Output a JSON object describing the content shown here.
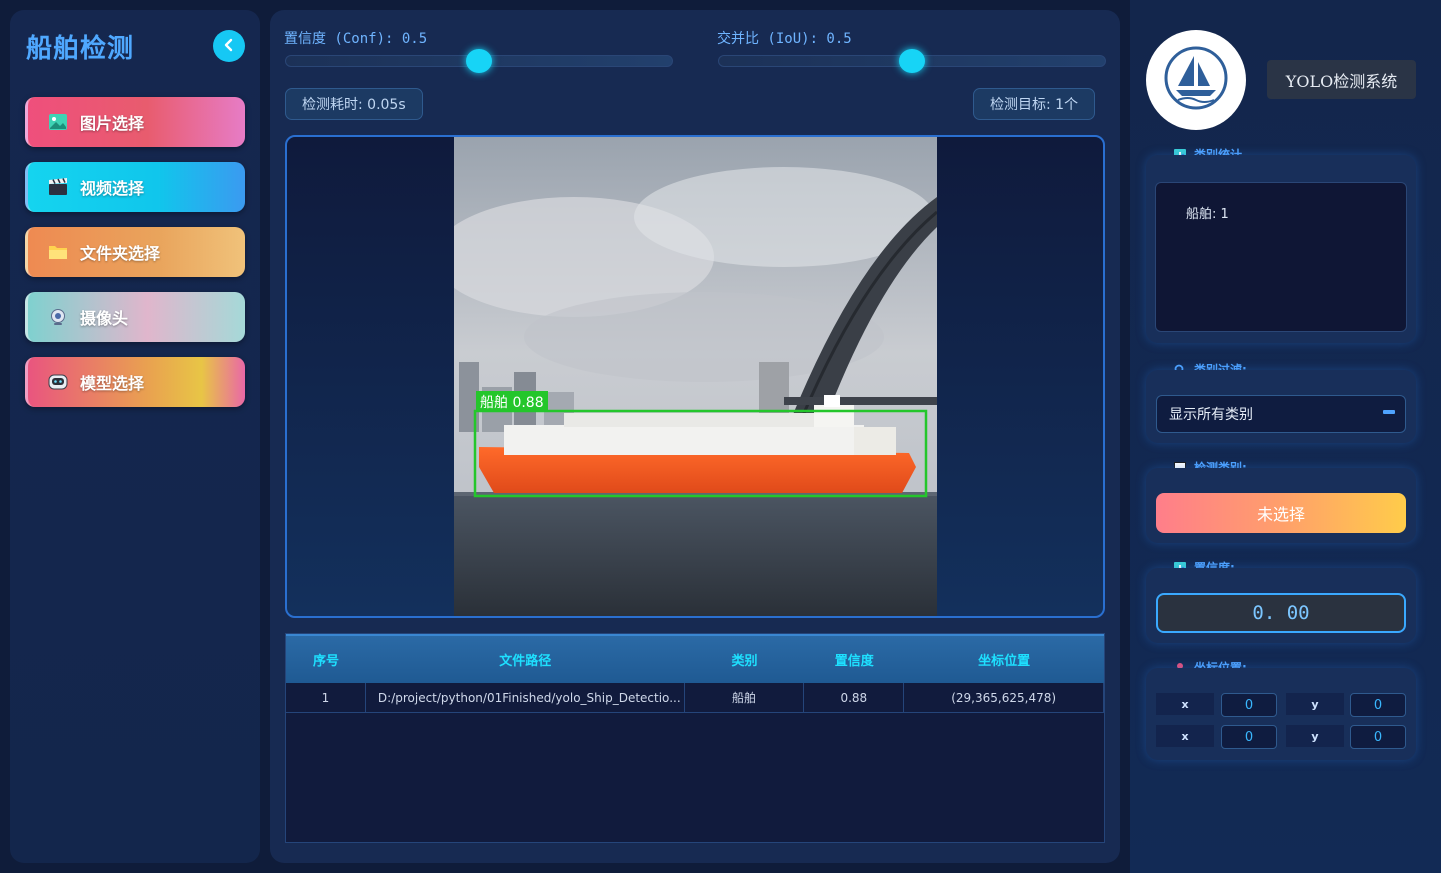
{
  "sidebar": {
    "title": "船舶检测",
    "buttons": {
      "image": "图片选择",
      "video": "视频选择",
      "folder": "文件夹选择",
      "camera": "摄像头",
      "model": "模型选择"
    }
  },
  "controls": {
    "conf_label": "置信度 (Conf): 0.5",
    "conf_value": 0.5,
    "iou_label": "交并比 (IoU): 0.5",
    "iou_value": 0.5,
    "time_label": "检测耗时: 0.05s",
    "targets_label": "检测目标: 1个"
  },
  "detection": {
    "box_label": "船舶 0.88",
    "color": "#24c62b"
  },
  "table": {
    "headers": [
      "序号",
      "文件路径",
      "类别",
      "置信度",
      "坐标位置"
    ],
    "rows": [
      [
        "1",
        "D:/project/python/01Finished/yolo_Ship_Detectio...",
        "船舶",
        "0.88",
        "(29,365,625,478)"
      ]
    ]
  },
  "right": {
    "system_title": "YOLO检测系统",
    "stats_title": "类别统计",
    "stats_text": "船舶: 1",
    "filter_title": "类别过滤:",
    "filter_value": "显示所有类别",
    "class_title": "检测类别:",
    "class_value": "未选择",
    "conf_title": "置信度:",
    "conf_value": "0. 00",
    "coord_title": "坐标位置:",
    "coords": {
      "x1_label": "x",
      "x1": "0",
      "y1_label": "y",
      "y1": "0",
      "x2_label": "x",
      "x2": "0",
      "y2_label": "y",
      "y2": "0"
    }
  },
  "colors": {
    "accent": "#17d4f6",
    "title_blue": "#4fa8ff"
  }
}
